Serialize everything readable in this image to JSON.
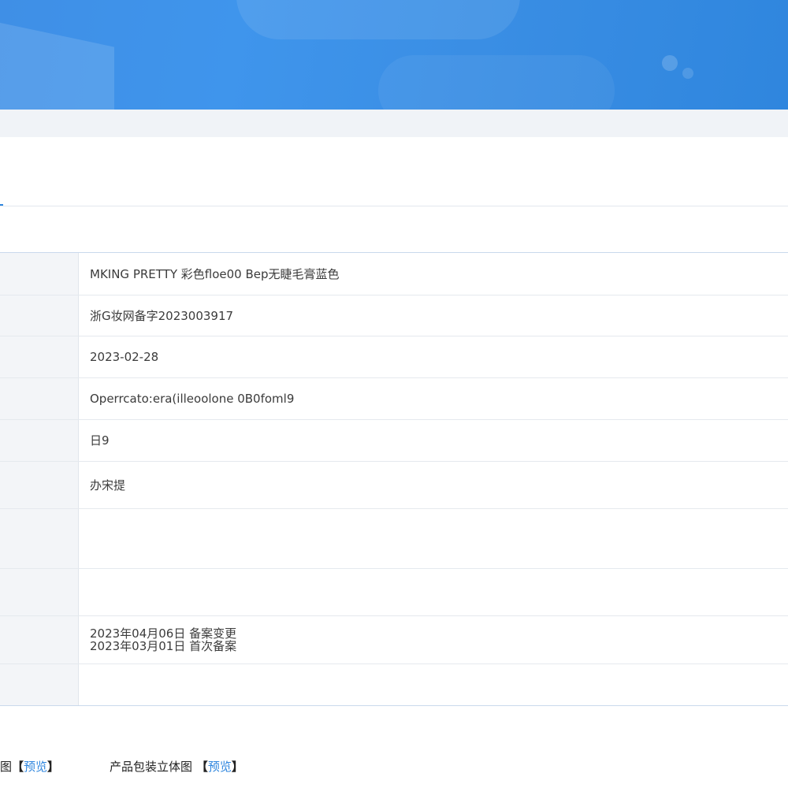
{
  "table": {
    "rows": [
      {
        "value": "MKING PRETTY 彩色floe00 Bep无睫毛膏蓝色"
      },
      {
        "value": "浙G妆网备字2023003917"
      },
      {
        "value": "2023-02-28"
      },
      {
        "value": "Operrcato:era(illeoolone 0B0foml9"
      },
      {
        "value": "日9"
      },
      {
        "value": "办宋提"
      },
      {
        "value": ""
      },
      {
        "value": ""
      },
      {
        "lines": [
          "2023年04月06日 备案变更",
          "2023年03月01日 首次备案"
        ]
      },
      {
        "value": ""
      }
    ]
  },
  "footer": {
    "item1": {
      "label": "图",
      "link": "预览"
    },
    "item2": {
      "label": "产品包装立体图",
      "link": "预览"
    }
  }
}
